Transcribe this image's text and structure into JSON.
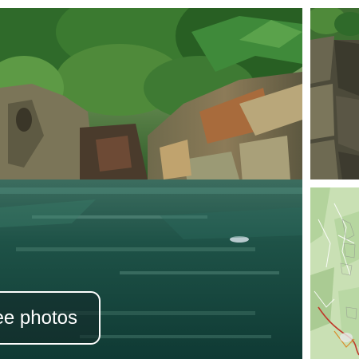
{
  "gallery": {
    "see_photos_label": "See photos",
    "main_photo_name": "river-gorge-photo",
    "side_photo_name": "rock-wall-photo",
    "map_name": "location-map"
  },
  "colors": {
    "water_dark": "#123c35",
    "water_light": "#4f8b7c",
    "foliage": "#2f6a2a",
    "rock": "#8a7a5a",
    "map_green": "#b9d6a2",
    "map_road": "#c0392b"
  }
}
